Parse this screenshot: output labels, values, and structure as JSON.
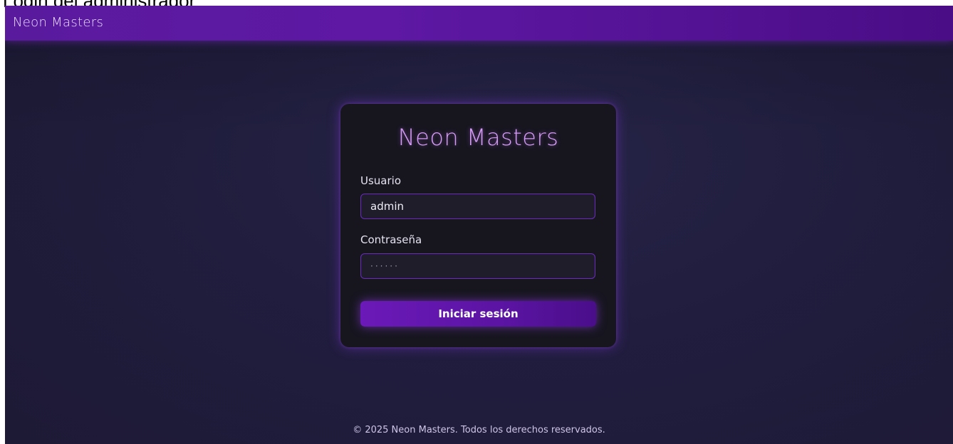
{
  "caption": "Login del administrador",
  "header": {
    "brand": "Neon Masters"
  },
  "login": {
    "title": "Neon Masters",
    "username_label": "Usuario",
    "username_value": "admin",
    "password_label": "Contraseña",
    "password_value": "······",
    "submit_label": "Iniciar sesión"
  },
  "footer": {
    "text": "© 2025 Neon Masters. Todos los derechos reservados."
  },
  "colors": {
    "header_bg": "#5e18a4",
    "accent": "#d59cf5",
    "card_bg": "#17161f",
    "page_bg": "#201d3d"
  }
}
